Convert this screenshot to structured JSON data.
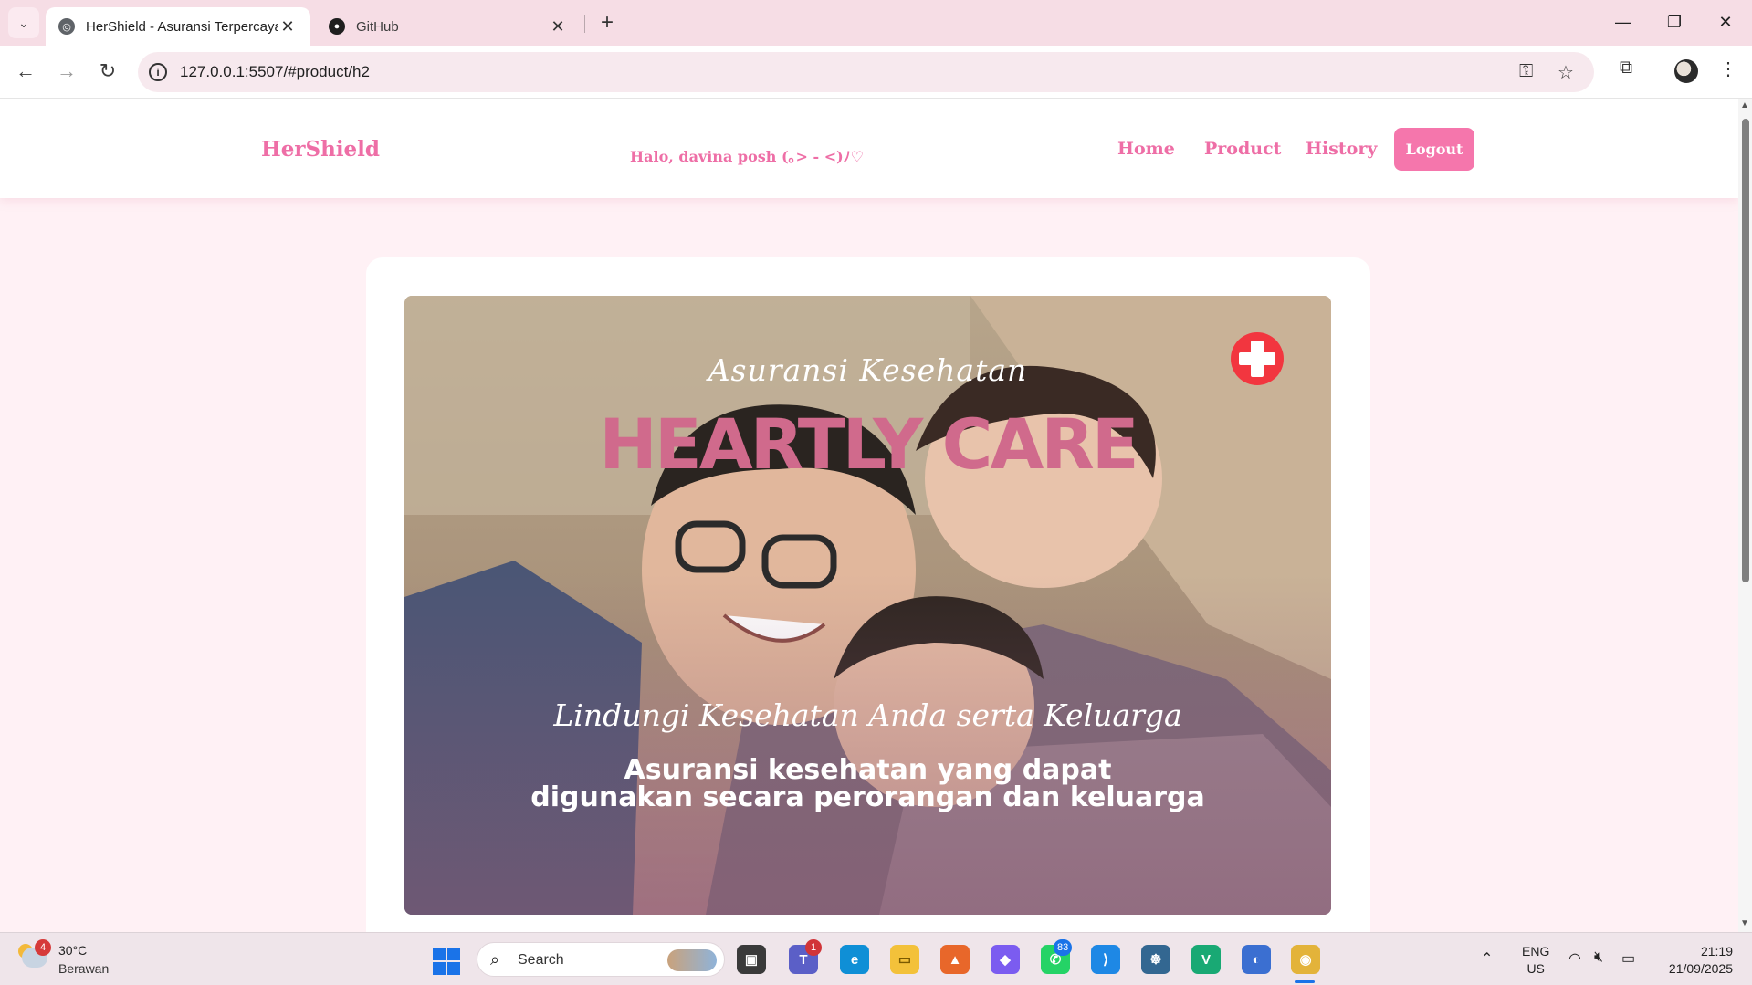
{
  "browser": {
    "tabs": [
      {
        "title": "HerShield - Asuransi Terpercaya",
        "active": true
      },
      {
        "title": "GitHub",
        "active": false
      }
    ],
    "url": "127.0.0.1:5507/#product/h2"
  },
  "site": {
    "brand": "HerShield",
    "greeting": "Halo, davina posh (｡> - <)ﾉ♡",
    "nav": [
      "Home",
      "Product",
      "History"
    ],
    "logout_label": "Logout"
  },
  "banner": {
    "script_top": "Asuransi Kesehatan",
    "title": "HEARTLY CARE",
    "script_bottom": "Lindungi Kesehatan Anda serta Keluarga",
    "subtitle_line1": "Asuransi kesehatan yang dapat",
    "subtitle_line2": "digunakan secara perorangan dan keluarga",
    "colors": {
      "title": "#d06a8c",
      "cross": "#f2363f"
    }
  },
  "taskbar": {
    "weather": {
      "temp": "30°C",
      "desc": "Berawan",
      "badge": "4"
    },
    "search_label": "Search",
    "teams_badge": "1",
    "whatsapp_badge": "83",
    "lang_line1": "ENG",
    "lang_line2": "US",
    "time": "21:19",
    "date": "21/09/2025"
  },
  "colors": {
    "accent": "#ee6ea6",
    "page_bg": "#fff1f5",
    "logout_bg": "#f576ac"
  }
}
